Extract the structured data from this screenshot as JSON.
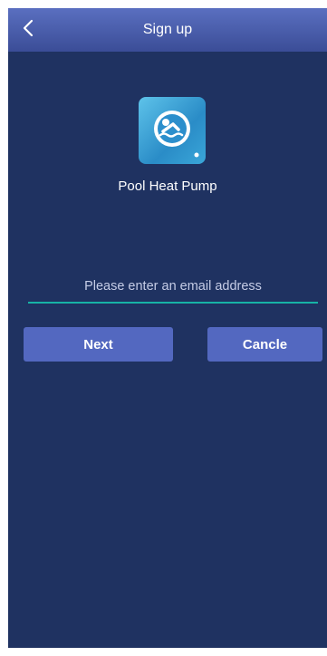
{
  "header": {
    "title": "Sign up",
    "back_icon": "chevron-left-icon"
  },
  "app": {
    "name": "Pool Heat Pump",
    "icon": "swimmer-icon"
  },
  "email": {
    "value": "",
    "placeholder": "Please enter an email address"
  },
  "buttons": {
    "next_label": "Next",
    "cancel_label": "Cancle"
  },
  "colors": {
    "background": "#1f3261",
    "header": "#4558a8",
    "button": "#5368c0",
    "input_underline": "#17b3a6"
  }
}
